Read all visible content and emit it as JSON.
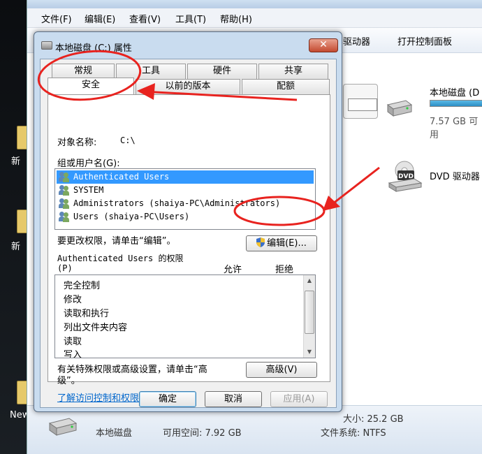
{
  "explorer": {
    "menu": [
      "文件(F)",
      "编辑(E)",
      "查看(V)",
      "工具(T)",
      "帮助(H)"
    ],
    "toolbar": {
      "drivers": "驱动器",
      "control_panel": "打开控制面板"
    },
    "drives": {
      "local_disk_label": "本地磁盘 (D",
      "local_disk_free": "7.57 GB 可用",
      "dvd_label": "DVD 驱动器",
      "dvd_icon_text": "DVD"
    },
    "status": {
      "size": "大小: 25.2 GB",
      "name": "本地磁盘",
      "free": "可用空间: 7.92 GB",
      "fs": "文件系统: NTFS"
    }
  },
  "desktop": {
    "label_1": "新",
    "label_2": "新",
    "label_3": "New"
  },
  "dialog": {
    "title": "本地磁盘 (C:) 属性",
    "close": "✕",
    "tabs_row1": [
      "常规",
      "工具",
      "硬件",
      "共享"
    ],
    "tabs_row2": [
      "安全",
      "以前的版本",
      "配额"
    ],
    "object_name_label": "对象名称:",
    "object_name_value": "C:\\",
    "group_label": "组或用户名(G):",
    "users": [
      "Authenticated Users",
      "SYSTEM",
      "Administrators (shaiya-PC\\Administrators)",
      "Users (shaiya-PC\\Users)"
    ],
    "change_hint": "要更改权限，请单击“编辑”。",
    "edit_button": "编辑(E)...",
    "perm_for_label": "Authenticated Users 的权限",
    "perm_p": "(P)",
    "allow_col": "允许",
    "deny_col": "拒绝",
    "permissions": [
      "完全控制",
      "修改",
      "读取和执行",
      "列出文件夹内容",
      "读取",
      "写入"
    ],
    "advanced_hint_1": "有关特殊权限或高级设置，请单击“高",
    "advanced_hint_2": "级”。",
    "advanced_button": "高级(V)",
    "learn_link": "了解访问控制和权限",
    "ok_button": "确定",
    "cancel_button": "取消",
    "apply_button": "应用(A)"
  },
  "colors": {
    "annotation": "#e8231f",
    "selection": "#3399ff"
  }
}
